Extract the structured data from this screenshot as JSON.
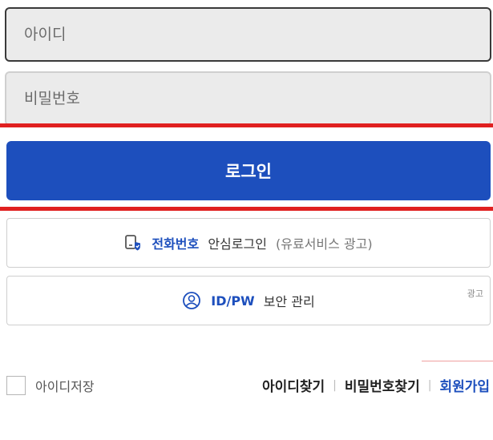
{
  "login_form": {
    "id_placeholder": "아이디",
    "pw_placeholder": "비밀번호",
    "login_label": "로그인"
  },
  "phone_login": {
    "strong": "전화번호",
    "normal": " 안심로그인",
    "muted": " (유료서비스 광고)"
  },
  "idpw": {
    "strong": "ID/PW",
    "normal": " 보안 관리",
    "ad_label": "광고"
  },
  "footer": {
    "save_id_label": "아이디저장",
    "find_id": "아이디찾기",
    "find_pw": "비밀번호찾기",
    "signup": "회원가입",
    "separator": "|"
  },
  "colors": {
    "primary_blue": "#1d4fbd",
    "highlight_red": "#e02020"
  },
  "icons": {
    "phone": "phone-shield-icon",
    "user": "user-circle-icon"
  }
}
